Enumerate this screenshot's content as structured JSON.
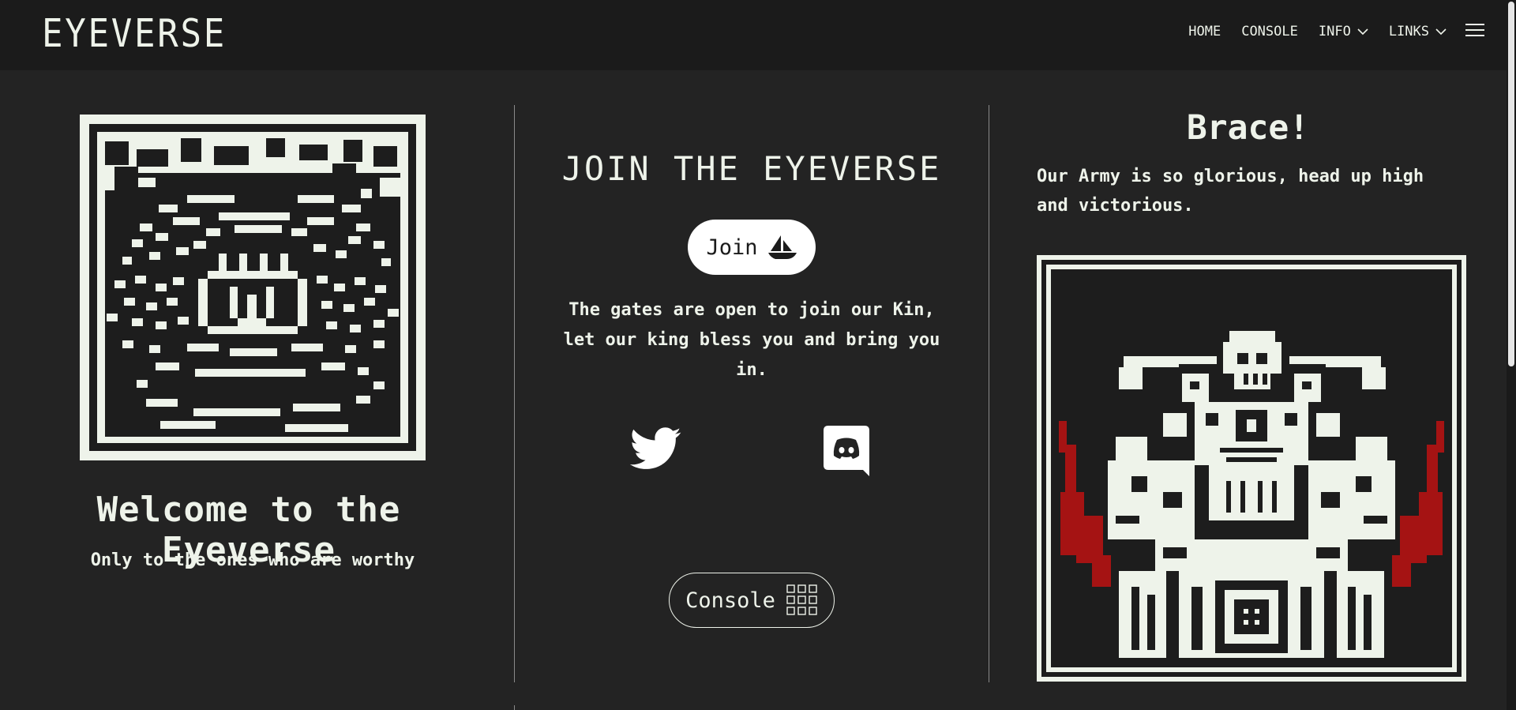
{
  "header": {
    "brand": "EYEVERSE",
    "nav": {
      "home": "HOME",
      "console": "CONSOLE",
      "info": "INFO",
      "links": "LINKS"
    }
  },
  "left": {
    "title": "Welcome to the Eyeverse",
    "subtitle": "Only to the ones who are worthy"
  },
  "middle": {
    "title": "JOIN THE EYEVERSE",
    "join_label": "Join",
    "description": "The gates are open to join our Kin, let our king bless you and bring you in.",
    "console_label": "Console"
  },
  "right": {
    "title": "Brace!",
    "text": "Our Army is so glorious, head up high and victorious."
  },
  "colors": {
    "background": "#232323",
    "header": "#1b1b1b",
    "foreground": "#eef3ea",
    "accent_red": "#a51313"
  },
  "icons": {
    "join": "sailboat-icon",
    "console": "grid-icon",
    "social": [
      "twitter-icon",
      "discord-icon"
    ],
    "menu": "hamburger-icon"
  }
}
